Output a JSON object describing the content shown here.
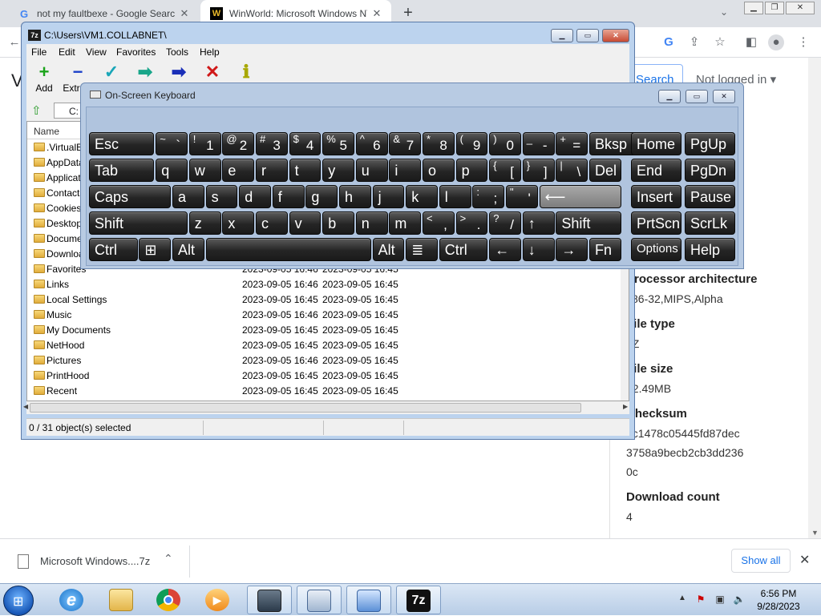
{
  "chrome": {
    "tabs": [
      {
        "title": "not my faultbexe - Google Search",
        "favicon": "G"
      },
      {
        "title": "WinWorld: Microsoft Windows NT",
        "favicon": "W"
      }
    ],
    "new_tab": "+",
    "tab_search": "⌄",
    "back": "←"
  },
  "webpage": {
    "heading_fragment": "V",
    "search_button": "Search",
    "login_label": "Not logged in",
    "info": [
      {
        "label": "Processor architecture",
        "value": "x86-32,MIPS,Alpha"
      },
      {
        "label": "File type",
        "value": "7Z"
      },
      {
        "label": "File size",
        "value": "12.49MB"
      },
      {
        "label": "Checksum",
        "value": "ec1478c05445fd87dec3758a9becb2cb3dd2360c"
      },
      {
        "label": "Download count",
        "value": "4"
      }
    ],
    "info_lines": {
      "proc_label": "Processor architecture",
      "proc_value": "x86-32,MIPS,Alpha",
      "type_label": "File type",
      "type_value": "7Z",
      "size_label": "File size",
      "size_value": "12.49MB",
      "checksum_label": "Checksum",
      "checksum_line1": "ec1478c05445fd87dec",
      "checksum_line2": "3758a9becb2cb3dd236",
      "checksum_line3": "0c",
      "dl_label": "Download count",
      "dl_value": "4"
    }
  },
  "download_bar": {
    "file_name": "Microsoft Windows....7z",
    "show_all": "Show all",
    "close": "✕"
  },
  "zip": {
    "title": "C:\\Users\\VM1.COLLABNET\\",
    "logo": "7z",
    "menu": [
      "File",
      "Edit",
      "View",
      "Favorites",
      "Tools",
      "Help"
    ],
    "toolbar": [
      {
        "label": "Add",
        "icon": "+",
        "color": "#1aa31a"
      },
      {
        "label": "Extract",
        "icon": "−",
        "color": "#1a3fc8"
      },
      {
        "label": "Test",
        "icon": "✓",
        "color": "#19a6b8"
      },
      {
        "label": "Copy",
        "icon": "➡",
        "color": "#19a68a"
      },
      {
        "label": "Move",
        "icon": "➡",
        "color": "#1a2fb8"
      },
      {
        "label": "Delete",
        "icon": "✕",
        "color": "#d01818"
      },
      {
        "label": "Info",
        "icon": "ℹ",
        "color": "#a8a800"
      }
    ],
    "address": "C:",
    "column_name": "Name",
    "files": [
      {
        "name": ".VirtualBox",
        "modified": "",
        "created": ""
      },
      {
        "name": "AppData",
        "modified": "",
        "created": ""
      },
      {
        "name": "Application Data",
        "modified": "",
        "created": ""
      },
      {
        "name": "Contacts",
        "modified": "",
        "created": ""
      },
      {
        "name": "Cookies",
        "modified": "",
        "created": ""
      },
      {
        "name": "Desktop",
        "modified": "",
        "created": ""
      },
      {
        "name": "Documents",
        "modified": "",
        "created": ""
      },
      {
        "name": "Downloads",
        "modified": "",
        "created": ""
      },
      {
        "name": "Favorites",
        "modified": "2023-09-05 16:46",
        "created": "2023-09-05 16:45"
      },
      {
        "name": "Links",
        "modified": "2023-09-05 16:46",
        "created": "2023-09-05 16:45"
      },
      {
        "name": "Local Settings",
        "modified": "2023-09-05 16:45",
        "created": "2023-09-05 16:45"
      },
      {
        "name": "Music",
        "modified": "2023-09-05 16:46",
        "created": "2023-09-05 16:45"
      },
      {
        "name": "My Documents",
        "modified": "2023-09-05 16:45",
        "created": "2023-09-05 16:45"
      },
      {
        "name": "NetHood",
        "modified": "2023-09-05 16:45",
        "created": "2023-09-05 16:45"
      },
      {
        "name": "Pictures",
        "modified": "2023-09-05 16:46",
        "created": "2023-09-05 16:45"
      },
      {
        "name": "PrintHood",
        "modified": "2023-09-05 16:45",
        "created": "2023-09-05 16:45"
      },
      {
        "name": "Recent",
        "modified": "2023-09-05 16:45",
        "created": "2023-09-05 16:45"
      }
    ],
    "status": "0 / 31 object(s) selected"
  },
  "osk": {
    "title": "On-Screen Keyboard",
    "rows": [
      [
        {
          "main": "Esc",
          "w": 2
        },
        {
          "top": "~",
          "bot": "`",
          "w": 1
        },
        {
          "top": "!",
          "bot": "1",
          "w": 1
        },
        {
          "top": "@",
          "bot": "2",
          "w": 1
        },
        {
          "top": "#",
          "bot": "3",
          "w": 1
        },
        {
          "top": "$",
          "bot": "4",
          "w": 1
        },
        {
          "top": "%",
          "bot": "5",
          "w": 1
        },
        {
          "top": "^",
          "bot": "6",
          "w": 1
        },
        {
          "top": "&",
          "bot": "7",
          "w": 1
        },
        {
          "top": "*",
          "bot": "8",
          "w": 1
        },
        {
          "top": "(",
          "bot": "9",
          "w": 1
        },
        {
          "top": ")",
          "bot": "0",
          "w": 1
        },
        {
          "top": "_",
          "bot": "-",
          "w": 1
        },
        {
          "top": "+",
          "bot": "=",
          "w": 1
        },
        {
          "main": "Bksp",
          "w": 2
        }
      ],
      [
        {
          "main": "Tab",
          "w": 2
        },
        {
          "main": "q",
          "w": 1
        },
        {
          "main": "w",
          "w": 1
        },
        {
          "main": "e",
          "w": 1
        },
        {
          "main": "r",
          "w": 1
        },
        {
          "main": "t",
          "w": 1
        },
        {
          "main": "y",
          "w": 1
        },
        {
          "main": "u",
          "w": 1
        },
        {
          "main": "i",
          "w": 1
        },
        {
          "main": "o",
          "w": 1
        },
        {
          "main": "p",
          "w": 1
        },
        {
          "top": "{",
          "bot": "[",
          "w": 1
        },
        {
          "top": "}",
          "bot": "]",
          "w": 1
        },
        {
          "top": "|",
          "bot": "\\",
          "w": 1
        },
        {
          "main": "Del",
          "w": 1
        }
      ],
      [
        {
          "main": "Caps",
          "w": 2.5
        },
        {
          "main": "a",
          "w": 1
        },
        {
          "main": "s",
          "w": 1
        },
        {
          "main": "d",
          "w": 1
        },
        {
          "main": "f",
          "w": 1
        },
        {
          "main": "g",
          "w": 1
        },
        {
          "main": "h",
          "w": 1
        },
        {
          "main": "j",
          "w": 1
        },
        {
          "main": "k",
          "w": 1
        },
        {
          "main": "l",
          "w": 1
        },
        {
          "top": ":",
          "bot": ";",
          "w": 1
        },
        {
          "top": "\"",
          "bot": "'",
          "w": 1
        },
        {
          "main": "⟵",
          "w": 2.5,
          "hover": true
        }
      ],
      [
        {
          "main": "Shift",
          "w": 3
        },
        {
          "main": "z",
          "w": 1
        },
        {
          "main": "x",
          "w": 1
        },
        {
          "main": "c",
          "w": 1
        },
        {
          "main": "v",
          "w": 1
        },
        {
          "main": "b",
          "w": 1
        },
        {
          "main": "n",
          "w": 1
        },
        {
          "main": "m",
          "w": 1
        },
        {
          "top": "<",
          "bot": ",",
          "w": 1
        },
        {
          "top": ">",
          "bot": ".",
          "w": 1
        },
        {
          "top": "?",
          "bot": "/",
          "w": 1
        },
        {
          "main": "↑",
          "w": 1
        },
        {
          "main": "Shift",
          "w": 2
        }
      ],
      [
        {
          "main": "Ctrl",
          "w": 1.5
        },
        {
          "main": "⊞",
          "w": 1
        },
        {
          "main": "Alt",
          "w": 1
        },
        {
          "main": "",
          "w": 5
        },
        {
          "main": "Alt",
          "w": 1
        },
        {
          "main": "≣",
          "w": 1
        },
        {
          "main": "Ctrl",
          "w": 1.5
        },
        {
          "main": "←",
          "w": 1
        },
        {
          "main": "↓",
          "w": 1
        },
        {
          "main": "→",
          "w": 1
        },
        {
          "main": "Fn",
          "w": 1
        }
      ]
    ],
    "nav_rows": [
      [
        "Home",
        "PgUp"
      ],
      [
        "End",
        "PgDn"
      ],
      [
        "Insert",
        "Pause"
      ],
      [
        "PrtScn",
        "ScrLk"
      ],
      [
        "Options",
        "Help"
      ]
    ]
  },
  "taskbar": {
    "clock_time": "6:56 PM",
    "clock_date": "9/28/2023",
    "apps": [
      "start-orb",
      "internet-explorer-icon",
      "file-explorer-icon",
      "chrome-icon",
      "media-player-icon",
      "virtualbox-icon",
      "keyboard-icon",
      "control-panel-icon",
      "7zip-icon"
    ]
  }
}
